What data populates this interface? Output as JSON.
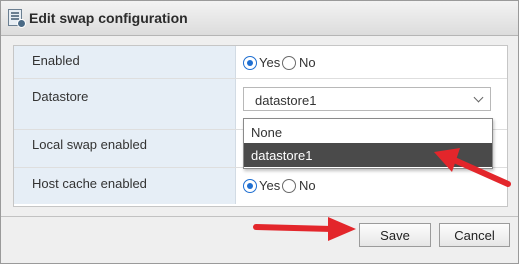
{
  "dialog": {
    "title": "Edit swap configuration",
    "icon": "swap-config-icon"
  },
  "form": {
    "enabled": {
      "label": "Enabled",
      "options": [
        "Yes",
        "No"
      ],
      "selected": "Yes"
    },
    "datastore": {
      "label": "Datastore",
      "value": "datastore1",
      "options": [
        "None",
        "datastore1"
      ],
      "highlighted": "datastore1"
    },
    "local_swap": {
      "label": "Local swap enabled"
    },
    "host_cache": {
      "label": "Host cache enabled",
      "options": [
        "Yes",
        "No"
      ],
      "selected": "Yes"
    }
  },
  "buttons": {
    "save": "Save",
    "cancel": "Cancel"
  },
  "colors": {
    "radio_checked": "#1f6fd1",
    "label_bg": "#e6eef6",
    "dropdown_selected": "#4a4a4a",
    "annotation_arrow": "#e3262b"
  }
}
